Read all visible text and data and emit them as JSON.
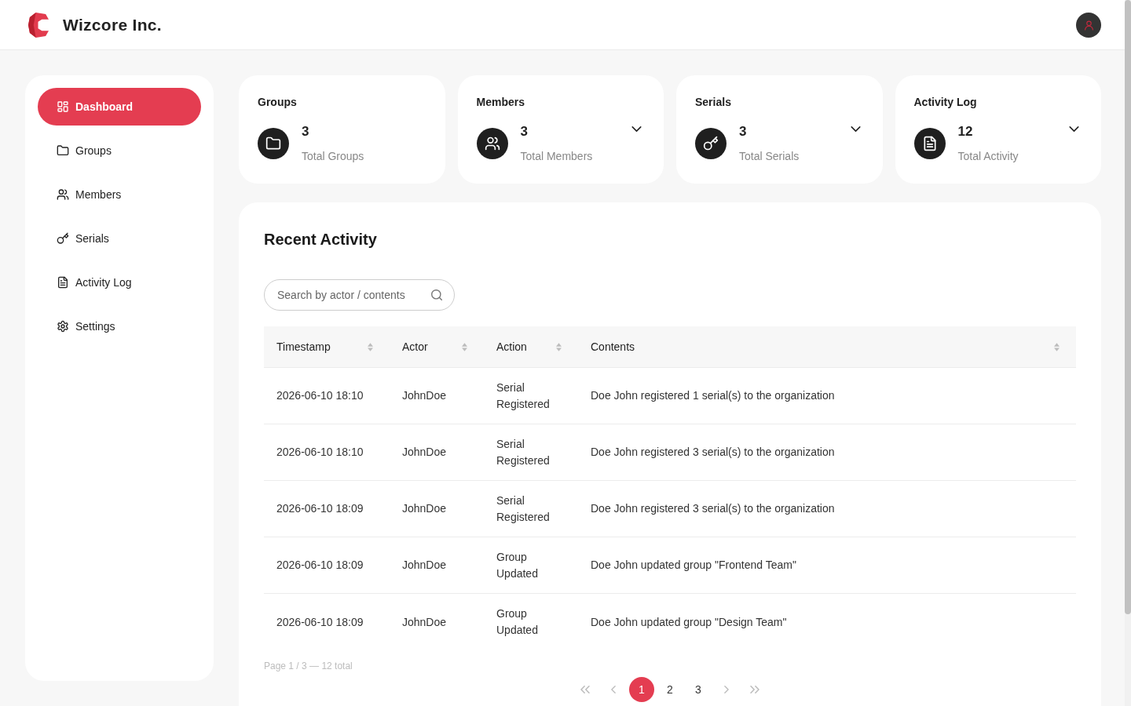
{
  "header": {
    "brand": "Wizcore Inc."
  },
  "sidebar": {
    "items": [
      {
        "label": "Dashboard",
        "selected": true
      },
      {
        "label": "Groups",
        "selected": false
      },
      {
        "label": "Members",
        "selected": false
      },
      {
        "label": "Serials",
        "selected": false
      },
      {
        "label": "Activity Log",
        "selected": false
      },
      {
        "label": "Settings",
        "selected": false
      }
    ]
  },
  "stat_cards": [
    {
      "title": "Groups",
      "value": "3",
      "caption": "Total Groups",
      "expandable": false
    },
    {
      "title": "Members",
      "value": "3",
      "caption": "Total Members",
      "expandable": true
    },
    {
      "title": "Serials",
      "value": "3",
      "caption": "Total Serials",
      "expandable": true
    },
    {
      "title": "Activity Log",
      "value": "12",
      "caption": "Total Activity",
      "expandable": true
    }
  ],
  "recent_activity": {
    "title": "Recent Activity",
    "search": {
      "placeholder": "Search by actor / contents"
    },
    "table": {
      "columns": [
        "Timestamp",
        "Actor",
        "Action",
        "Contents"
      ],
      "rows": [
        [
          "2026-06-10 18:10",
          "JohnDoe",
          "Serial Registered",
          "Doe John registered 1 serial(s) to the organization"
        ],
        [
          "2026-06-10 18:10",
          "JohnDoe",
          "Serial Registered",
          "Doe John registered 3 serial(s) to the organization"
        ],
        [
          "2026-06-10 18:09",
          "JohnDoe",
          "Serial Registered",
          "Doe John registered 3 serial(s) to the organization"
        ],
        [
          "2026-06-10 18:09",
          "JohnDoe",
          "Group Updated",
          "Doe John updated group \"Frontend Team\""
        ],
        [
          "2026-06-10 18:09",
          "JohnDoe",
          "Group Updated",
          "Doe John updated group \"Design Team\""
        ]
      ]
    },
    "page_info": "Page 1 / 3 — 12 total",
    "pagination": {
      "pages": [
        {
          "label": "1",
          "selected": true
        },
        {
          "label": "2",
          "selected": false
        },
        {
          "label": "3",
          "selected": false
        }
      ]
    }
  }
}
